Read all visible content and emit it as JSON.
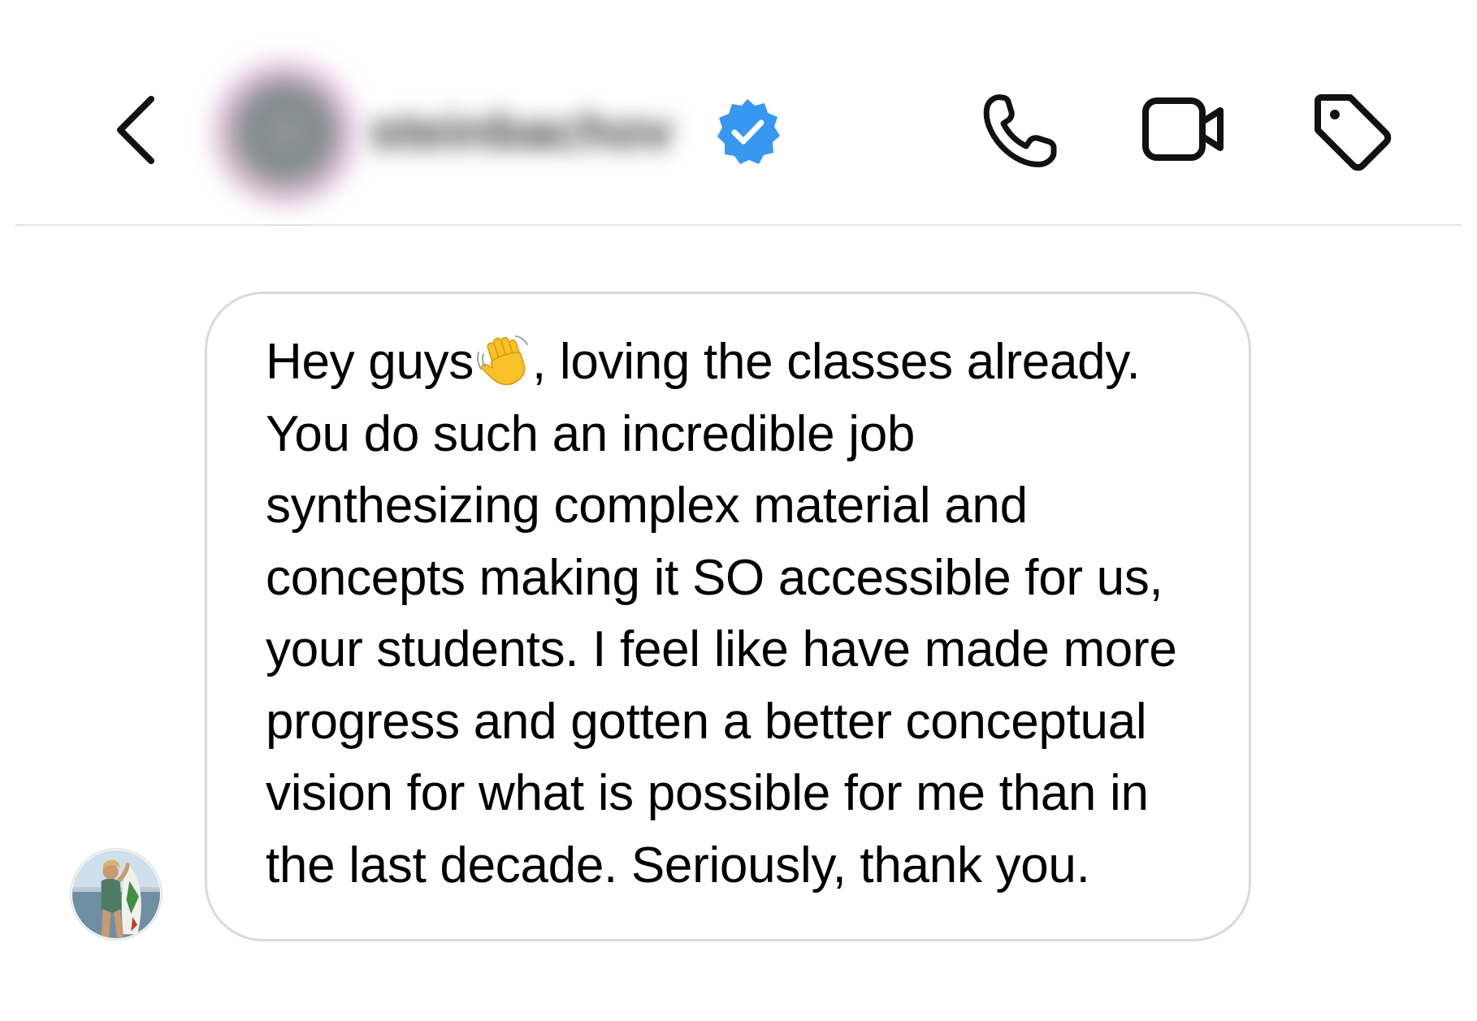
{
  "header": {
    "username": "steinbachov",
    "back_icon": "chevron-left-icon",
    "verified_icon": "verified-badge-icon",
    "verified_color": "#3897f0",
    "actions": [
      {
        "icon": "phone-icon",
        "label": "Audio call"
      },
      {
        "icon": "video-camera-icon",
        "label": "Video call"
      },
      {
        "icon": "tag-icon",
        "label": "Label"
      }
    ]
  },
  "message": {
    "lines": [
      "Hey guys",
      ", loving the classes already.",
      "You do such an incredible job",
      "synthesizing complex material and",
      "concepts making it SO accessible for us,",
      "your students. I feel like have made more",
      "progress and gotten a better conceptual",
      "vision for what is possible for me than in",
      "the last decade. Seriously, thank you."
    ],
    "emoji": "waving-hand",
    "sender_avatar": "user-photo"
  }
}
